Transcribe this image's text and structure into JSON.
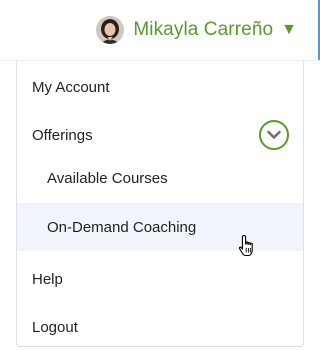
{
  "header": {
    "user_name": "Mikayla Carreño",
    "caret_glyph": "▼",
    "accent_color": "#5a9a2a"
  },
  "menu": {
    "items": [
      {
        "label": "My Account"
      },
      {
        "label": "Offerings",
        "expanded": true,
        "subitems": [
          {
            "label": "Available Courses"
          },
          {
            "label": "On-Demand Coaching",
            "hovered": true
          }
        ]
      },
      {
        "label": "Help"
      },
      {
        "label": "Logout"
      }
    ]
  },
  "icons": {
    "avatar": "user-avatar-photo",
    "collapse": "chevron-down-circle-icon",
    "cursor": "hand-pointer-cursor"
  }
}
